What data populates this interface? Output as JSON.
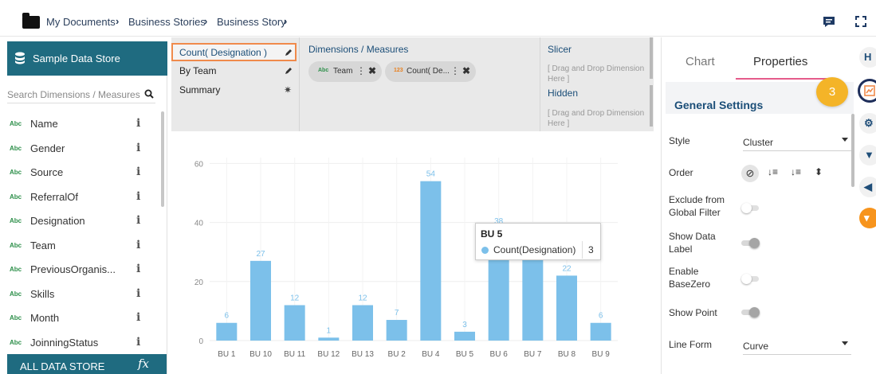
{
  "breadcrumb": [
    "My Documents",
    "Business Stories",
    "Business Story"
  ],
  "sidebar": {
    "store_name": "Sample Data Store",
    "search_placeholder": "Search Dimensions / Measures",
    "fields": [
      {
        "type": "Abc",
        "name": "Name"
      },
      {
        "type": "Abc",
        "name": "Gender"
      },
      {
        "type": "Abc",
        "name": "Source"
      },
      {
        "type": "Abc",
        "name": "ReferralOf"
      },
      {
        "type": "Abc",
        "name": "Designation"
      },
      {
        "type": "Abc",
        "name": "Team"
      },
      {
        "type": "Abc",
        "name": "PreviousOrganis..."
      },
      {
        "type": "Abc",
        "name": "Skills"
      },
      {
        "type": "Abc",
        "name": "Month"
      },
      {
        "type": "Abc",
        "name": "JoinningStatus"
      }
    ],
    "all_store_label": "ALL DATA STORE",
    "fx_label": "fx"
  },
  "shelf": {
    "rows": [
      "Count( Designation )",
      "By Team",
      "Summary"
    ],
    "dimensions_title": "Dimensions / Measures",
    "chips": [
      {
        "type": "Abc",
        "label": "Team"
      },
      {
        "type": "123",
        "label": "Count( De..."
      }
    ],
    "slicer_title": "Slicer",
    "slicer_placeholder": "[ Drag and Drop Dimension Here ]",
    "hidden_title": "Hidden",
    "hidden_placeholder": "[ Drag and Drop Dimension Here ]"
  },
  "chart_data": {
    "type": "bar",
    "categories": [
      "BU 1",
      "BU 10",
      "BU 11",
      "BU 12",
      "BU 13",
      "BU 2",
      "BU 4",
      "BU 5",
      "BU 6",
      "BU 7",
      "BU 8",
      "BU 9"
    ],
    "series": [
      {
        "name": "Count(Designation)",
        "values": [
          6,
          27,
          12,
          1,
          12,
          7,
          54,
          3,
          38,
          35,
          22,
          6
        ]
      }
    ],
    "data_labels": [
      "6",
      "27",
      "12",
      "1",
      "12",
      "7",
      "54",
      "3",
      "38",
      "35",
      "22",
      "6"
    ],
    "yticks": [
      0,
      20,
      40,
      60
    ],
    "ylim": [
      0,
      62
    ],
    "grid": true,
    "bar_color": "#7cc0ea",
    "label_color": "#7cc0ea"
  },
  "tooltip": {
    "title": "BU 5",
    "series": "Count(Designation)",
    "value": "3"
  },
  "panel": {
    "tabs": [
      "Chart",
      "Properties"
    ],
    "section_title": "General Settings",
    "style_label": "Style",
    "style_value": "Cluster",
    "order_label": "Order",
    "exclude_label": [
      "Exclude from",
      "Global Filter"
    ],
    "show_data_label": [
      "Show Data",
      "Label"
    ],
    "enable_basezero_label": [
      "Enable",
      "BaseZero"
    ],
    "show_point_label": "Show Point",
    "line_form_label": "Line Form",
    "line_form_value": "Curve"
  },
  "step_badge": "3",
  "colors": {
    "brand": "#1f6b80",
    "accent": "#e55b8b",
    "badge": "#f4b428",
    "highlight": "#f08a4b"
  }
}
